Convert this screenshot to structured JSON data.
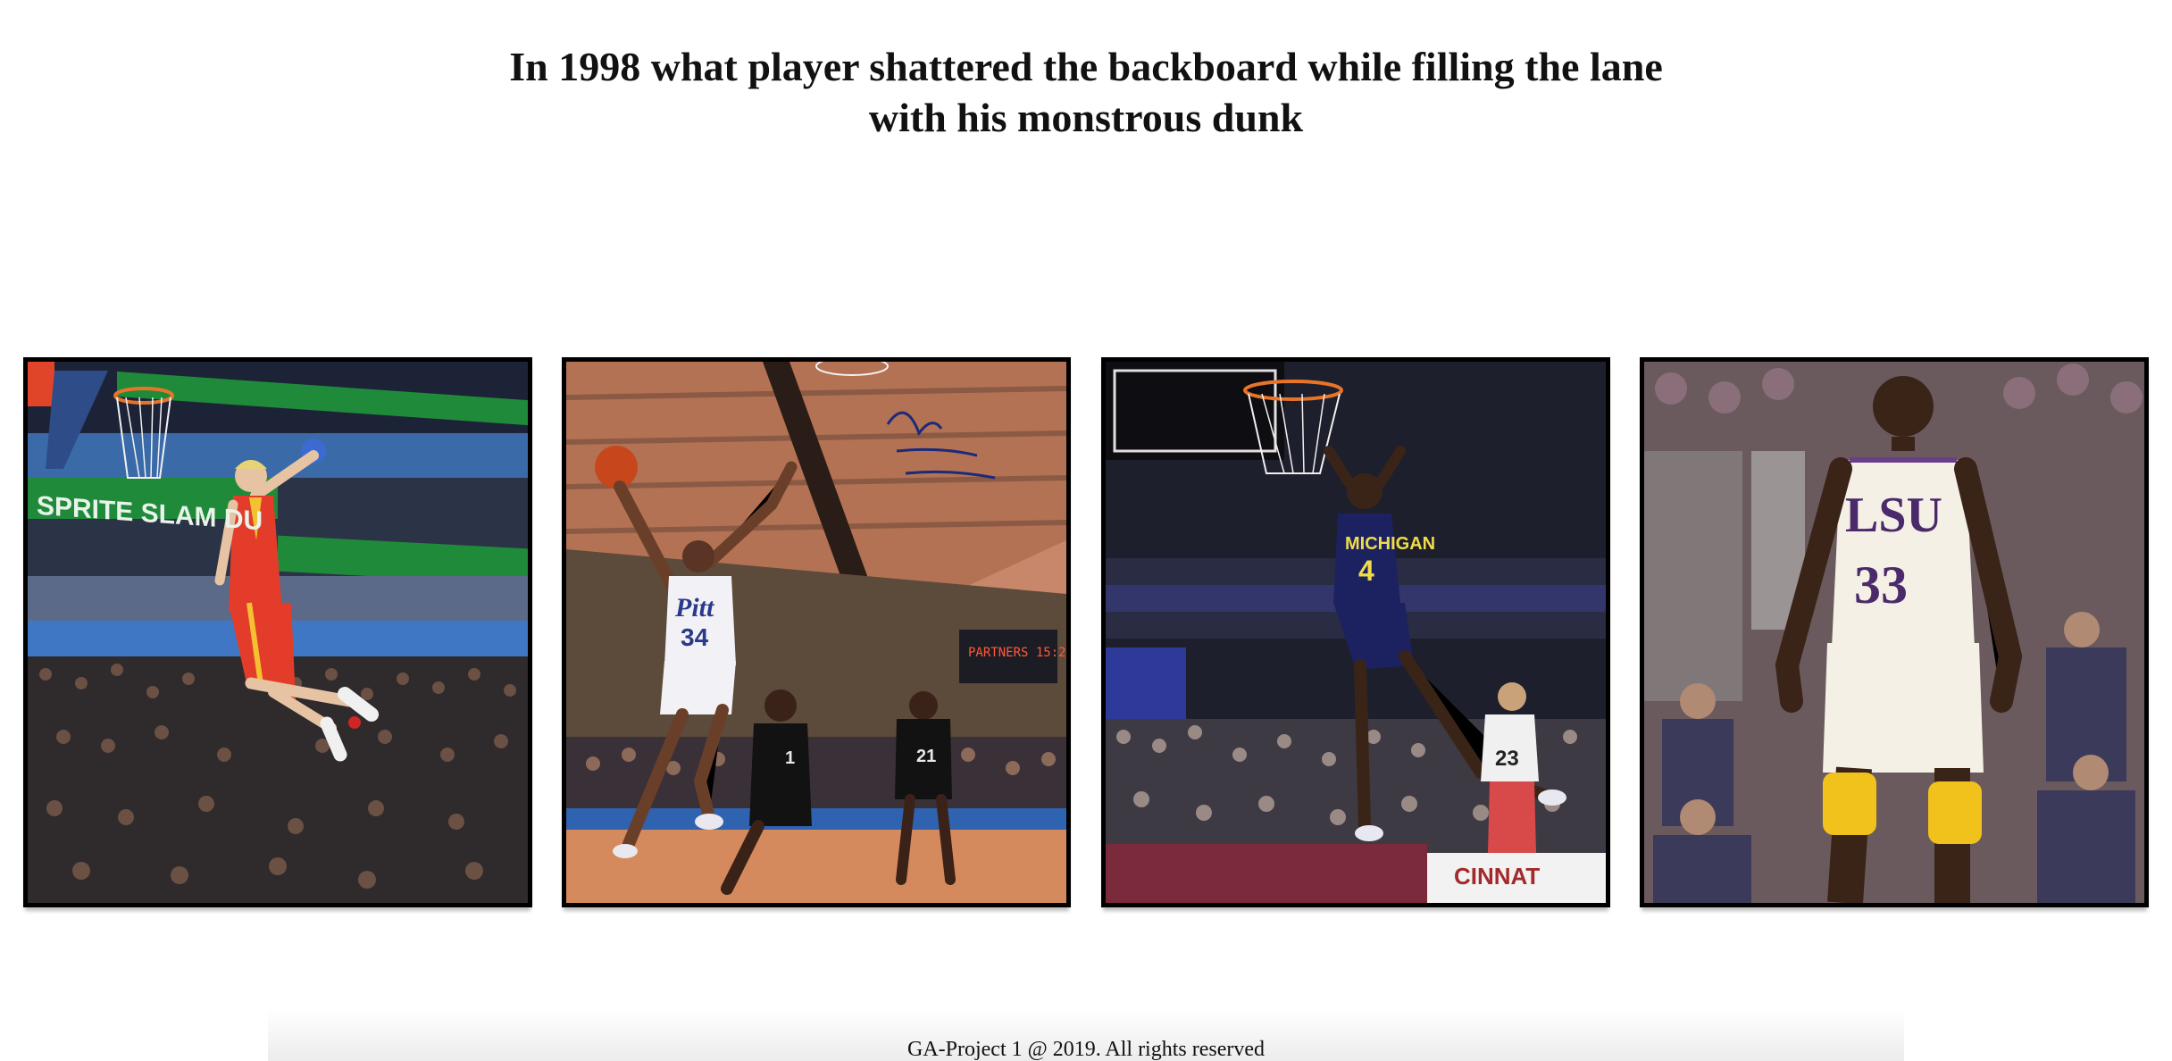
{
  "question": "In 1998 what player shattered the backboard while filling the lane with his monstrous dunk",
  "choices": [
    {
      "id": "choice-1",
      "image_label": "player-dunk-sprite-slam-dunk",
      "jersey_number": ""
    },
    {
      "id": "choice-2",
      "image_label": "player-dunk-pitt-34",
      "jersey_number": "34"
    },
    {
      "id": "choice-3",
      "image_label": "player-dunk-michigan-4",
      "jersey_number": "4"
    },
    {
      "id": "choice-4",
      "image_label": "player-standing-lsu-33",
      "jersey_number": "33"
    }
  ],
  "footer": {
    "text": "GA-Project 1 @ 2019. All rights reserved"
  }
}
